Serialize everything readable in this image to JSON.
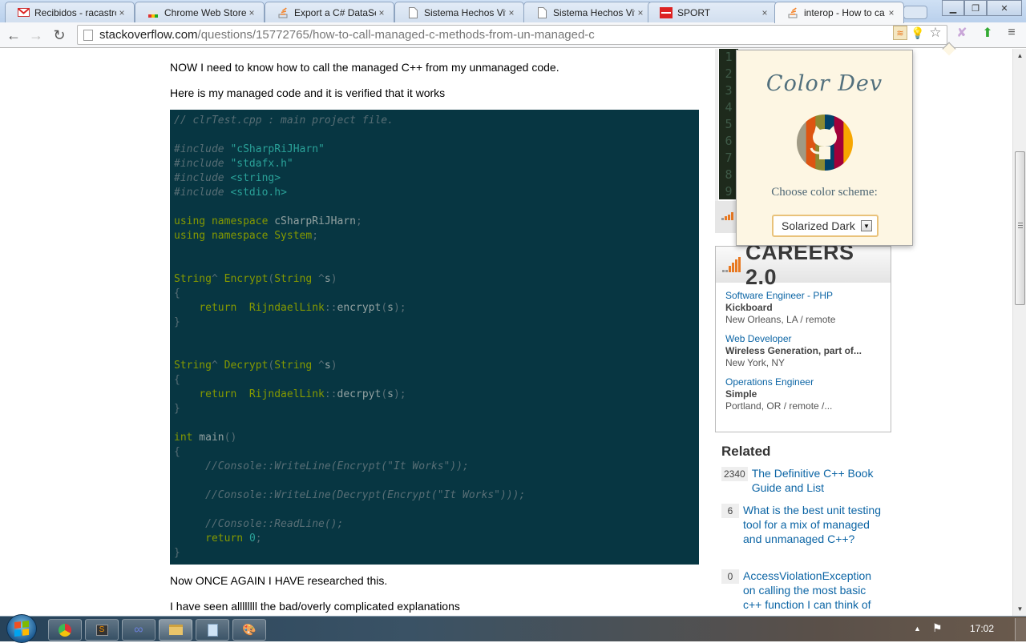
{
  "browser": {
    "tabs": [
      {
        "label": "Recibidos - racastro",
        "icon": "gmail-icon",
        "active": false
      },
      {
        "label": "Chrome Web Store",
        "icon": "chrome-web-store-icon",
        "active": false
      },
      {
        "label": "Export a C# DataSet",
        "icon": "stackoverflow-icon",
        "active": false
      },
      {
        "label": "Sistema Hechos Vita",
        "icon": "page-icon",
        "active": false
      },
      {
        "label": "Sistema Hechos Vita",
        "icon": "page-icon",
        "active": false
      },
      {
        "label": "SPORT",
        "icon": "sport-icon",
        "active": false
      },
      {
        "label": "interop - How to ca",
        "icon": "stackoverflow-icon",
        "active": true
      }
    ],
    "url_host": "stackoverflow.com",
    "url_path": "/questions/15772765/how-to-call-managed-c-methods-from-un-managed-c",
    "close_glyph": "×"
  },
  "post": {
    "para1": "NOW I need to know how to call the managed C++ from my unmanaged code.",
    "para2": "Here is my managed code and it is verified that it works",
    "para3": "Now ONCE AGAIN I HAVE researched this.",
    "para4": "I have seen allllllll the bad/overly complicated explanations"
  },
  "code": [
    [
      [
        "c-com",
        "// clrTest.cpp : main project file."
      ]
    ],
    [],
    [
      [
        "c-com",
        "#include"
      ],
      [
        "c-pl",
        " "
      ],
      [
        "c-str",
        "\"cSharpRiJHarn\""
      ]
    ],
    [
      [
        "c-com",
        "#include"
      ],
      [
        "c-pl",
        " "
      ],
      [
        "c-str",
        "\"stdafx.h\""
      ]
    ],
    [
      [
        "c-com",
        "#include"
      ],
      [
        "c-pl",
        " "
      ],
      [
        "c-str",
        "<string>"
      ]
    ],
    [
      [
        "c-com",
        "#include"
      ],
      [
        "c-pl",
        " "
      ],
      [
        "c-str",
        "<stdio.h>"
      ]
    ],
    [],
    [
      [
        "c-kw",
        "using namespace"
      ],
      [
        "c-pl",
        " cSharpRiJHarn"
      ],
      [
        "c-punc",
        ";"
      ]
    ],
    [
      [
        "c-kw",
        "using namespace System"
      ],
      [
        "c-punc",
        ";"
      ]
    ],
    [],
    [],
    [
      [
        "c-kw",
        "String"
      ],
      [
        "c-punc",
        "^"
      ],
      [
        "c-kw",
        " Encrypt"
      ],
      [
        "c-punc",
        "("
      ],
      [
        "c-kw",
        "String"
      ],
      [
        "c-punc",
        " ^"
      ],
      [
        "c-pl",
        "s"
      ],
      [
        "c-punc",
        ")"
      ]
    ],
    [
      [
        "c-punc",
        "{"
      ]
    ],
    [
      [
        "c-pl",
        "    "
      ],
      [
        "c-kw",
        "return  RijndaelLink"
      ],
      [
        "c-punc",
        "::"
      ],
      [
        "c-pl",
        "encrypt"
      ],
      [
        "c-punc",
        "("
      ],
      [
        "c-pl",
        "s"
      ],
      [
        "c-punc",
        ");"
      ]
    ],
    [
      [
        "c-punc",
        "}"
      ]
    ],
    [],
    [],
    [
      [
        "c-kw",
        "String"
      ],
      [
        "c-punc",
        "^"
      ],
      [
        "c-kw",
        " Decrypt"
      ],
      [
        "c-punc",
        "("
      ],
      [
        "c-kw",
        "String"
      ],
      [
        "c-punc",
        " ^"
      ],
      [
        "c-pl",
        "s"
      ],
      [
        "c-punc",
        ")"
      ]
    ],
    [
      [
        "c-punc",
        "{"
      ]
    ],
    [
      [
        "c-pl",
        "    "
      ],
      [
        "c-kw",
        "return  RijndaelLink"
      ],
      [
        "c-punc",
        "::"
      ],
      [
        "c-pl",
        "decrpyt"
      ],
      [
        "c-punc",
        "("
      ],
      [
        "c-pl",
        "s"
      ],
      [
        "c-punc",
        ");"
      ]
    ],
    [
      [
        "c-punc",
        "}"
      ]
    ],
    [],
    [
      [
        "c-kw",
        "int"
      ],
      [
        "c-pl",
        " main"
      ],
      [
        "c-punc",
        "()"
      ]
    ],
    [
      [
        "c-punc",
        "{"
      ]
    ],
    [
      [
        "c-pl",
        "     "
      ],
      [
        "c-com",
        "//Console::WriteLine(Encrypt(\"It Works\"));"
      ]
    ],
    [],
    [
      [
        "c-pl",
        "     "
      ],
      [
        "c-com",
        "//Console::WriteLine(Decrypt(Encrypt(\"It Works\")));"
      ]
    ],
    [],
    [
      [
        "c-pl",
        "     "
      ],
      [
        "c-com",
        "//Console::ReadLine();"
      ]
    ],
    [
      [
        "c-pl",
        "     "
      ],
      [
        "c-kw",
        "return"
      ],
      [
        "c-pl",
        " "
      ],
      [
        "c-num",
        "0"
      ],
      [
        "c-punc",
        ";"
      ]
    ],
    [
      [
        "c-punc",
        "}"
      ]
    ]
  ],
  "ad": {
    "line_numbers": [
      "1",
      "2",
      "3",
      "4",
      "5",
      "6",
      "7",
      "8",
      "9"
    ]
  },
  "careers": {
    "title": "CAREERS 2.0",
    "jobs": [
      {
        "title": "Software Engineer - PHP",
        "company": "Kickboard",
        "location": "New Orleans, LA / remote"
      },
      {
        "title": "Web Developer",
        "company": "Wireless Generation, part of...",
        "location": "New York, NY"
      },
      {
        "title": "Operations Engineer",
        "company": "Simple",
        "location": "Portland, OR / remote /..."
      }
    ]
  },
  "related": {
    "heading": "Related",
    "items": [
      {
        "count": "2340",
        "title": "The Definitive C++ Book Guide and List"
      },
      {
        "count": "6",
        "title": "What is the best unit testing tool for a mix of managed and unmanaged C++?"
      },
      {
        "count": "0",
        "title": "AccessViolationException on calling the most basic c++ function I can think of"
      }
    ]
  },
  "popup": {
    "title": "Color Dev",
    "label": "Choose color scheme:",
    "selected_scheme": "Solarized Dark",
    "logo_colors": [
      "#a09a85",
      "#dd5512",
      "#8c8a33",
      "#01426a",
      "#a1003a",
      "#f7a600"
    ]
  },
  "taskbar": {
    "apps": [
      "chrome-icon",
      "sublime-text-icon",
      "infinity-app-icon",
      "windows-explorer-icon",
      "notepad-icon",
      "paint-icon"
    ],
    "clock": "17:02"
  }
}
